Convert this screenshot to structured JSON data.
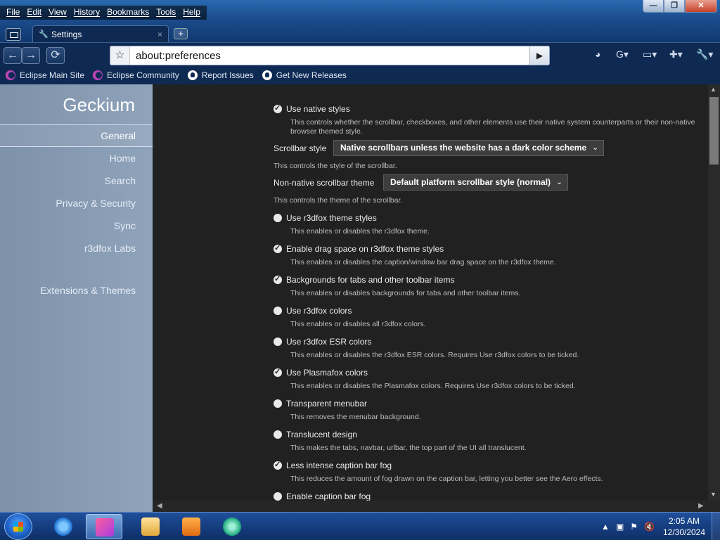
{
  "menubar": [
    "File",
    "Edit",
    "View",
    "History",
    "Bookmarks",
    "Tools",
    "Help"
  ],
  "window_controls": {
    "minimize": "—",
    "maximize": "❐",
    "close": "✕"
  },
  "tab": {
    "title": "Settings",
    "close": "×",
    "new_tab": "+"
  },
  "navbar": {
    "back": "←",
    "forward": "→",
    "reload": "⟳",
    "url": "about:preferences",
    "go": "▶"
  },
  "bookmarks": [
    "Eclipse Main Site",
    "Eclipse Community",
    "Report Issues",
    "Get New Releases"
  ],
  "sidebar": {
    "brand": "Geckium",
    "items": [
      "General",
      "Home",
      "Search",
      "Privacy & Security",
      "Sync",
      "r3dfox Labs",
      "Extensions & Themes"
    ]
  },
  "settings": {
    "native_styles": {
      "label": "Use native styles",
      "checked": true,
      "desc": "This controls whether the scrollbar, checkboxes, and other elements use their native system counterparts or their non-native browser themed style."
    },
    "scrollbar_style": {
      "label": "Scrollbar style",
      "value": "Native scrollbars unless the website has a dark color scheme",
      "desc": "This controls the style of the scrollbar."
    },
    "scrollbar_theme": {
      "label": "Non-native scrollbar theme",
      "value": "Default platform scrollbar style (normal)",
      "desc": "This controls the theme of the scrollbar."
    },
    "options": [
      {
        "label": "Use r3dfox theme styles",
        "checked": false,
        "desc": "This enables or disables the r3dfox theme."
      },
      {
        "label": "Enable drag space on r3dfox theme styles",
        "checked": true,
        "desc": "This enables or disables the caption/window bar drag space on the r3dfox theme."
      },
      {
        "label": "Backgrounds for tabs and other toolbar items",
        "checked": true,
        "desc": "This enables or disables backgrounds for tabs and other toolbar items."
      },
      {
        "label": "Use r3dfox colors",
        "checked": false,
        "desc": "This enables or disables all r3dfox colors."
      },
      {
        "label": "Use r3dfox ESR colors",
        "checked": false,
        "desc": "This enables or disables the r3dfox ESR colors. Requires Use r3dfox colors to be ticked."
      },
      {
        "label": "Use Plasmafox colors",
        "checked": true,
        "desc": "This enables or disables the Plasmafox colors. Requires Use r3dfox colors to be ticked."
      },
      {
        "label": "Transparent menubar",
        "checked": false,
        "desc": "This removes the menubar background."
      },
      {
        "label": "Translucent design",
        "checked": false,
        "desc": "This makes the tabs, navbar, urlbar, the top part of the UI all translucent."
      },
      {
        "label": "Less intense caption bar fog",
        "checked": true,
        "desc": "This reduces the amount of fog drawn on the caption bar, letting you better see the Aero effects."
      },
      {
        "label": "Enable caption bar fog",
        "checked": false,
        "desc": ""
      }
    ]
  },
  "taskbar": {
    "time": "2:05 AM",
    "date": "12/30/2024"
  }
}
